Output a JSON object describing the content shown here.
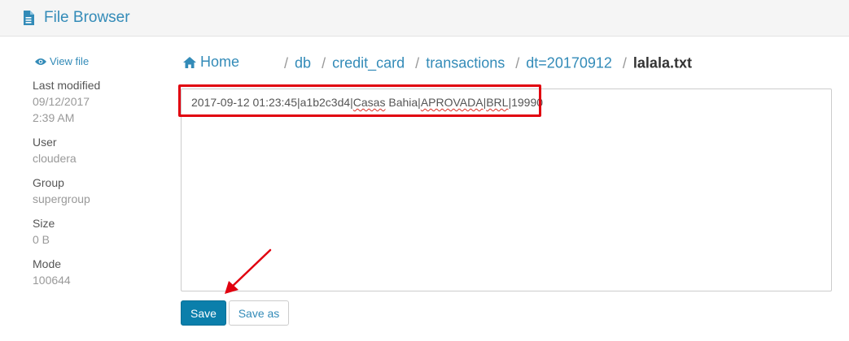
{
  "header": {
    "title": "File Browser",
    "icon": "file-icon"
  },
  "sidebar": {
    "view_file_label": "View file",
    "view_file_icon": "eye-icon",
    "metadata": [
      {
        "label": "Last modified",
        "value": "09/12/2017 2:39 AM"
      },
      {
        "label": "User",
        "value": "cloudera"
      },
      {
        "label": "Group",
        "value": "supergroup"
      },
      {
        "label": "Size",
        "value": "0 B"
      },
      {
        "label": "Mode",
        "value": "100644"
      }
    ]
  },
  "breadcrumb": {
    "home_label": "Home",
    "home_icon": "home-icon",
    "items": [
      "db",
      "credit_card",
      "transactions",
      "dt=20170912"
    ],
    "current": "lalala.txt"
  },
  "editor": {
    "segments": {
      "s1": "2017-09-12 01:23:45|a1b2c3d4|",
      "s2": "Casas",
      "s3": " Bahia|",
      "s4": "APROVADA",
      "s5": "|",
      "s6": "BRL",
      "s7": "|19990"
    }
  },
  "actions": {
    "save_label": "Save",
    "save_as_label": "Save as"
  },
  "colors": {
    "accent": "#338bb8",
    "primary_button": "#0b7fab",
    "annotation": "#e1000f",
    "spellcheck": "#d93025"
  }
}
